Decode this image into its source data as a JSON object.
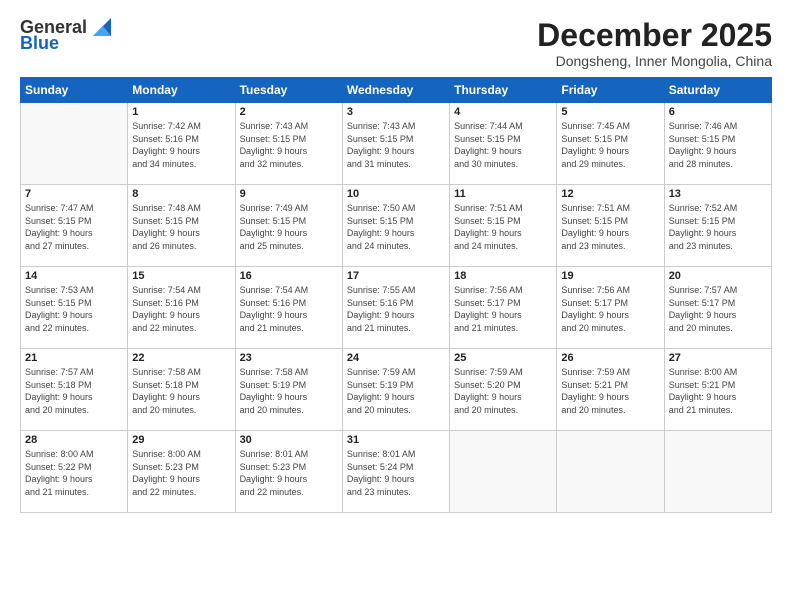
{
  "logo": {
    "general": "General",
    "blue": "Blue"
  },
  "title": "December 2025",
  "location": "Dongsheng, Inner Mongolia, China",
  "days_header": [
    "Sunday",
    "Monday",
    "Tuesday",
    "Wednesday",
    "Thursday",
    "Friday",
    "Saturday"
  ],
  "weeks": [
    [
      {
        "day": "",
        "info": ""
      },
      {
        "day": "1",
        "info": "Sunrise: 7:42 AM\nSunset: 5:16 PM\nDaylight: 9 hours\nand 34 minutes."
      },
      {
        "day": "2",
        "info": "Sunrise: 7:43 AM\nSunset: 5:15 PM\nDaylight: 9 hours\nand 32 minutes."
      },
      {
        "day": "3",
        "info": "Sunrise: 7:43 AM\nSunset: 5:15 PM\nDaylight: 9 hours\nand 31 minutes."
      },
      {
        "day": "4",
        "info": "Sunrise: 7:44 AM\nSunset: 5:15 PM\nDaylight: 9 hours\nand 30 minutes."
      },
      {
        "day": "5",
        "info": "Sunrise: 7:45 AM\nSunset: 5:15 PM\nDaylight: 9 hours\nand 29 minutes."
      },
      {
        "day": "6",
        "info": "Sunrise: 7:46 AM\nSunset: 5:15 PM\nDaylight: 9 hours\nand 28 minutes."
      }
    ],
    [
      {
        "day": "7",
        "info": "Sunrise: 7:47 AM\nSunset: 5:15 PM\nDaylight: 9 hours\nand 27 minutes."
      },
      {
        "day": "8",
        "info": "Sunrise: 7:48 AM\nSunset: 5:15 PM\nDaylight: 9 hours\nand 26 minutes."
      },
      {
        "day": "9",
        "info": "Sunrise: 7:49 AM\nSunset: 5:15 PM\nDaylight: 9 hours\nand 25 minutes."
      },
      {
        "day": "10",
        "info": "Sunrise: 7:50 AM\nSunset: 5:15 PM\nDaylight: 9 hours\nand 24 minutes."
      },
      {
        "day": "11",
        "info": "Sunrise: 7:51 AM\nSunset: 5:15 PM\nDaylight: 9 hours\nand 24 minutes."
      },
      {
        "day": "12",
        "info": "Sunrise: 7:51 AM\nSunset: 5:15 PM\nDaylight: 9 hours\nand 23 minutes."
      },
      {
        "day": "13",
        "info": "Sunrise: 7:52 AM\nSunset: 5:15 PM\nDaylight: 9 hours\nand 23 minutes."
      }
    ],
    [
      {
        "day": "14",
        "info": "Sunrise: 7:53 AM\nSunset: 5:15 PM\nDaylight: 9 hours\nand 22 minutes."
      },
      {
        "day": "15",
        "info": "Sunrise: 7:54 AM\nSunset: 5:16 PM\nDaylight: 9 hours\nand 22 minutes."
      },
      {
        "day": "16",
        "info": "Sunrise: 7:54 AM\nSunset: 5:16 PM\nDaylight: 9 hours\nand 21 minutes."
      },
      {
        "day": "17",
        "info": "Sunrise: 7:55 AM\nSunset: 5:16 PM\nDaylight: 9 hours\nand 21 minutes."
      },
      {
        "day": "18",
        "info": "Sunrise: 7:56 AM\nSunset: 5:17 PM\nDaylight: 9 hours\nand 21 minutes."
      },
      {
        "day": "19",
        "info": "Sunrise: 7:56 AM\nSunset: 5:17 PM\nDaylight: 9 hours\nand 20 minutes."
      },
      {
        "day": "20",
        "info": "Sunrise: 7:57 AM\nSunset: 5:17 PM\nDaylight: 9 hours\nand 20 minutes."
      }
    ],
    [
      {
        "day": "21",
        "info": "Sunrise: 7:57 AM\nSunset: 5:18 PM\nDaylight: 9 hours\nand 20 minutes."
      },
      {
        "day": "22",
        "info": "Sunrise: 7:58 AM\nSunset: 5:18 PM\nDaylight: 9 hours\nand 20 minutes."
      },
      {
        "day": "23",
        "info": "Sunrise: 7:58 AM\nSunset: 5:19 PM\nDaylight: 9 hours\nand 20 minutes."
      },
      {
        "day": "24",
        "info": "Sunrise: 7:59 AM\nSunset: 5:19 PM\nDaylight: 9 hours\nand 20 minutes."
      },
      {
        "day": "25",
        "info": "Sunrise: 7:59 AM\nSunset: 5:20 PM\nDaylight: 9 hours\nand 20 minutes."
      },
      {
        "day": "26",
        "info": "Sunrise: 7:59 AM\nSunset: 5:21 PM\nDaylight: 9 hours\nand 20 minutes."
      },
      {
        "day": "27",
        "info": "Sunrise: 8:00 AM\nSunset: 5:21 PM\nDaylight: 9 hours\nand 21 minutes."
      }
    ],
    [
      {
        "day": "28",
        "info": "Sunrise: 8:00 AM\nSunset: 5:22 PM\nDaylight: 9 hours\nand 21 minutes."
      },
      {
        "day": "29",
        "info": "Sunrise: 8:00 AM\nSunset: 5:23 PM\nDaylight: 9 hours\nand 22 minutes."
      },
      {
        "day": "30",
        "info": "Sunrise: 8:01 AM\nSunset: 5:23 PM\nDaylight: 9 hours\nand 22 minutes."
      },
      {
        "day": "31",
        "info": "Sunrise: 8:01 AM\nSunset: 5:24 PM\nDaylight: 9 hours\nand 23 minutes."
      },
      {
        "day": "",
        "info": ""
      },
      {
        "day": "",
        "info": ""
      },
      {
        "day": "",
        "info": ""
      }
    ]
  ]
}
